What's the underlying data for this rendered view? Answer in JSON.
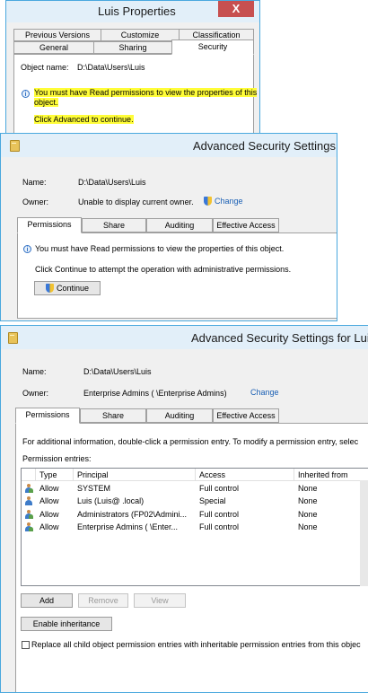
{
  "props": {
    "title": "Luis Properties",
    "close_glyph": "X",
    "tabs_top": [
      "Previous Versions",
      "Customize",
      "Classification"
    ],
    "tabs_bottom": [
      "General",
      "Sharing",
      "Security"
    ],
    "object_label": "Object name:",
    "object_value": "D:\\Data\\Users\\Luis",
    "warning_line1": "You must have Read permissions to view the properties of this",
    "warning_line2": "object.",
    "advanced_msg": "Click Advanced to continue."
  },
  "adv1": {
    "title": "Advanced Security Settings for",
    "name_label": "Name:",
    "name_value": "D:\\Data\\Users\\Luis",
    "owner_label": "Owner:",
    "owner_value": "Unable to display current owner.",
    "change_link": "Change",
    "tabs": [
      "Permissions",
      "Share",
      "Auditing",
      "Effective Access"
    ],
    "warning": "You must have Read permissions to view the properties of this object.",
    "continue_msg": "Click Continue to attempt the operation with administrative permissions.",
    "continue_button": "Continue"
  },
  "adv2": {
    "title": "Advanced Security Settings for Luis",
    "name_label": "Name:",
    "name_value": "D:\\Data\\Users\\Luis",
    "owner_label": "Owner:",
    "owner_value": "Enterprise Admins (        \\Enterprise Admins)",
    "change_link": "Change",
    "tabs": [
      "Permissions",
      "Share",
      "Auditing",
      "Effective Access"
    ],
    "info": "For additional information, double-click a permission entry. To modify a permission entry, selec",
    "entries_label": "Permission entries:",
    "columns": [
      "Type",
      "Principal",
      "Access",
      "Inherited from"
    ],
    "rows": [
      {
        "type": "Allow",
        "principal": "SYSTEM",
        "access": "Full control",
        "inherited": "None"
      },
      {
        "type": "Allow",
        "principal": "Luis           (Luis@          .local)",
        "access": "Special",
        "inherited": "None"
      },
      {
        "type": "Allow",
        "principal": "Administrators (FP02\\Admini...",
        "access": "Full control",
        "inherited": "None"
      },
      {
        "type": "Allow",
        "principal": "Enterprise Admins (           \\Enter...",
        "access": "Full control",
        "inherited": "None"
      }
    ],
    "add_button": "Add",
    "remove_button": "Remove",
    "view_button": "View",
    "enable_button": "Enable inheritance",
    "replace_label": "Replace all child object permission entries with inheritable permission entries from this objec"
  },
  "colors": {
    "highlight": "#fffd38",
    "link": "#1a5fb4",
    "close": "#c75050",
    "border": "#4aa8de"
  }
}
